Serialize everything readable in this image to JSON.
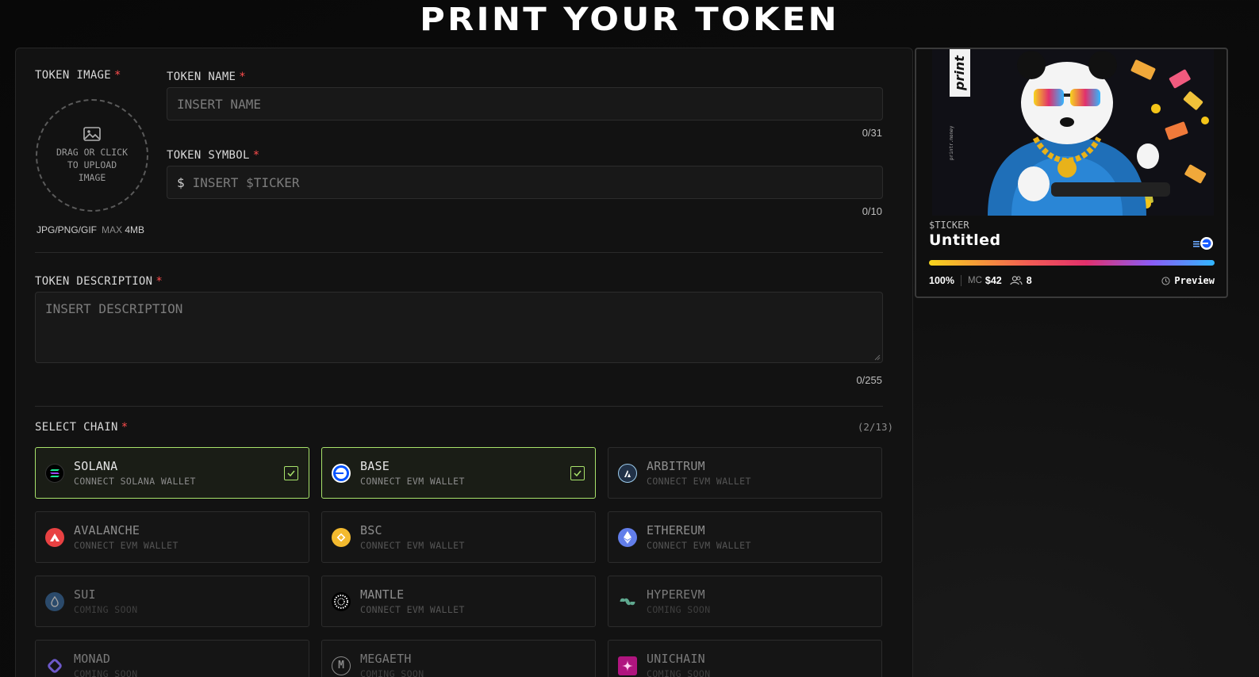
{
  "page": {
    "title": "PRINT YOUR TOKEN"
  },
  "form": {
    "token_image": {
      "label": "TOKEN IMAGE",
      "required_mark": "*",
      "upload_hint": "DRAG OR CLICK TO UPLOAD IMAGE",
      "formats": "JPG/PNG/GIF",
      "max_label": "MAX",
      "max_value": "4MB"
    },
    "token_name": {
      "label": "TOKEN NAME",
      "required_mark": "*",
      "placeholder": "INSERT NAME",
      "counter": "0/31"
    },
    "token_symbol": {
      "label": "TOKEN SYMBOL",
      "required_mark": "*",
      "prefix": "$",
      "placeholder": "INSERT $TICKER",
      "counter": "0/10"
    },
    "token_description": {
      "label": "TOKEN DESCRIPTION",
      "required_mark": "*",
      "placeholder": "INSERT DESCRIPTION",
      "counter": "0/255"
    },
    "select_chain": {
      "label": "SELECT CHAIN",
      "required_mark": "*",
      "count": "(2/13)",
      "chains": [
        {
          "name": "SOLANA",
          "sub": "CONNECT SOLANA WALLET",
          "state": "selected",
          "icon": "solana-icon",
          "color": "#000000"
        },
        {
          "name": "BASE",
          "sub": "CONNECT EVM WALLET",
          "state": "selected",
          "icon": "base-icon",
          "color": "#0052ff"
        },
        {
          "name": "ARBITRUM",
          "sub": "CONNECT EVM WALLET",
          "state": "available",
          "icon": "arbitrum-icon",
          "color": "#213147"
        },
        {
          "name": "AVALANCHE",
          "sub": "CONNECT EVM WALLET",
          "state": "available",
          "icon": "avalanche-icon",
          "color": "#e84142"
        },
        {
          "name": "BSC",
          "sub": "CONNECT EVM WALLET",
          "state": "available",
          "icon": "bsc-icon",
          "color": "#f3ba2f"
        },
        {
          "name": "ETHEREUM",
          "sub": "CONNECT EVM WALLET",
          "state": "available",
          "icon": "ethereum-icon",
          "color": "#627eea"
        },
        {
          "name": "SUI",
          "sub": "COMING SOON",
          "state": "soon",
          "icon": "sui-icon",
          "color": "#4da2ff"
        },
        {
          "name": "MANTLE",
          "sub": "CONNECT EVM WALLET",
          "state": "available",
          "icon": "mantle-icon",
          "color": "#000000"
        },
        {
          "name": "HYPEREVM",
          "sub": "COMING SOON",
          "state": "soon",
          "icon": "hyperevm-icon",
          "color": "#97fce4"
        },
        {
          "name": "MONAD",
          "sub": "COMING SOON",
          "state": "soon",
          "icon": "monad-icon",
          "color": "#836ef9"
        },
        {
          "name": "MEGAETH",
          "sub": "COMING SOON",
          "state": "soon",
          "icon": "megaeth-icon",
          "color": "#cccccc"
        },
        {
          "name": "UNICHAIN",
          "sub": "COMING SOON",
          "state": "soon",
          "icon": "unichain-icon",
          "color": "#f50db4"
        }
      ]
    }
  },
  "preview": {
    "ticker": "$TICKER",
    "name": "Untitled",
    "progress_percent": 100,
    "progress_label": "100%",
    "mc_label": "MC",
    "mc_value": "$42",
    "holders": "8",
    "preview_label": "Preview",
    "art_logo": "print",
    "art_caption": "printr.money"
  },
  "colors": {
    "accent_selected": "#a8e36b",
    "required": "#ff4d4d"
  }
}
